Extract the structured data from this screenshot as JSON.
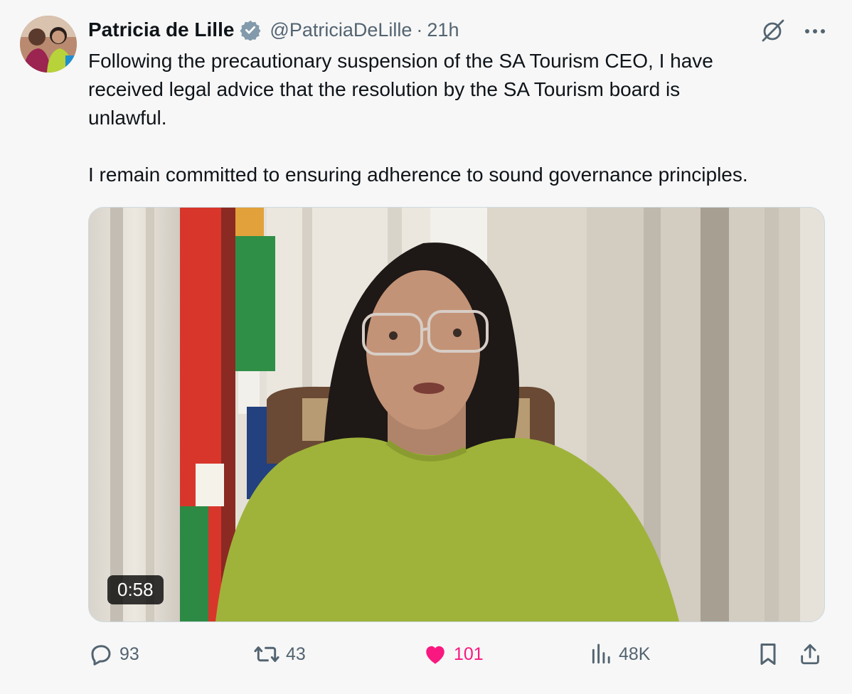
{
  "tweet": {
    "author": {
      "display_name": "Patricia de Lille",
      "handle": "@PatriciaDeLille",
      "verified": true,
      "avatar_icon": "profile-photo"
    },
    "separator": "·",
    "time": "21h",
    "text_paragraphs": [
      "Following the precautionary suspension of the SA Tourism CEO, I have\nreceived legal advice that the resolution by the SA Tourism board is\nunlawful.",
      "I remain committed to ensuring adherence to sound governance principles."
    ],
    "media": {
      "type": "video",
      "duration": "0:58"
    },
    "actions": {
      "replies": "93",
      "reposts": "43",
      "likes": "101",
      "views": "48K"
    },
    "icons": {
      "verified": "verified-badge-icon",
      "grok": "grok-icon",
      "more": "more-icon",
      "reply": "reply-icon",
      "repost": "repost-icon",
      "like": "heart-icon",
      "views": "views-icon",
      "bookmark": "bookmark-icon",
      "share": "share-icon"
    },
    "colors": {
      "like": "#f91880",
      "muted": "#536471",
      "text": "#0f1419"
    }
  }
}
